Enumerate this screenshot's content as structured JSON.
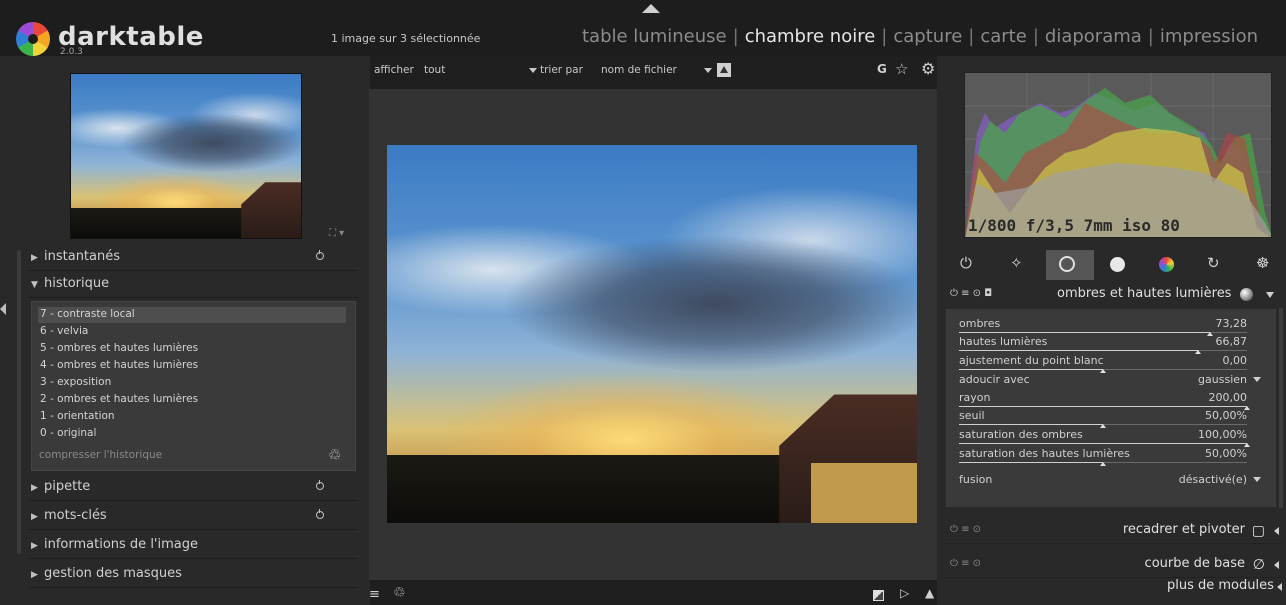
{
  "header": {
    "app_name": "darktable",
    "version": "2.0.3",
    "selection_status": "1 image sur 3 sélectionnée",
    "views": [
      "table lumineuse",
      "chambre noire",
      "capture",
      "carte",
      "diaporama",
      "impression"
    ],
    "active_view": "chambre noire"
  },
  "filmstrip_toolbar": {
    "filter_label": "afficher",
    "filter_value": "tout",
    "sort_label": "trier par",
    "sort_value": "nom de fichier",
    "grouping_label": "G"
  },
  "left_panel": {
    "modules": {
      "snapshots": "instantanés",
      "history": "historique",
      "color_picker": "pipette",
      "tagging": "mots-clés",
      "image_info": "informations de l'image",
      "mask_manager": "gestion des masques"
    },
    "history_items": [
      "7 - contraste local",
      "6 - velvia",
      "5 - ombres et hautes lumières",
      "4 - ombres et hautes lumières",
      "3 - exposition",
      "2 - ombres et hautes lumières",
      "1 - orientation",
      "0 - original"
    ],
    "compress_history": "compresser l'historique"
  },
  "right_panel": {
    "exif_summary": "1/800 f/3,5 7mm iso 80",
    "active_module": {
      "title": "ombres et hautes lumières",
      "params": [
        {
          "name": "ombres",
          "value": "73,28",
          "level": 0.87
        },
        {
          "name": "hautes lumières",
          "value": "66,87",
          "level": 0.83
        },
        {
          "name": "ajustement du point blanc",
          "value": "0,00",
          "level": 0.5
        },
        {
          "name": "rayon",
          "value": "200,00",
          "level": 1.0
        },
        {
          "name": "seuil",
          "value": "50,00%",
          "level": 0.5
        },
        {
          "name": "saturation des ombres",
          "value": "100,00%",
          "level": 1.0
        },
        {
          "name": "saturation des hautes lumières",
          "value": "50,00%",
          "level": 0.5
        }
      ],
      "soften_with_label": "adoucir avec",
      "soften_with_value": "gaussien",
      "blend_label": "fusion",
      "blend_value": "désactivé(e)"
    },
    "other_modules": [
      "recadrer et pivoter",
      "courbe de base"
    ],
    "more_modules": "plus de modules"
  }
}
